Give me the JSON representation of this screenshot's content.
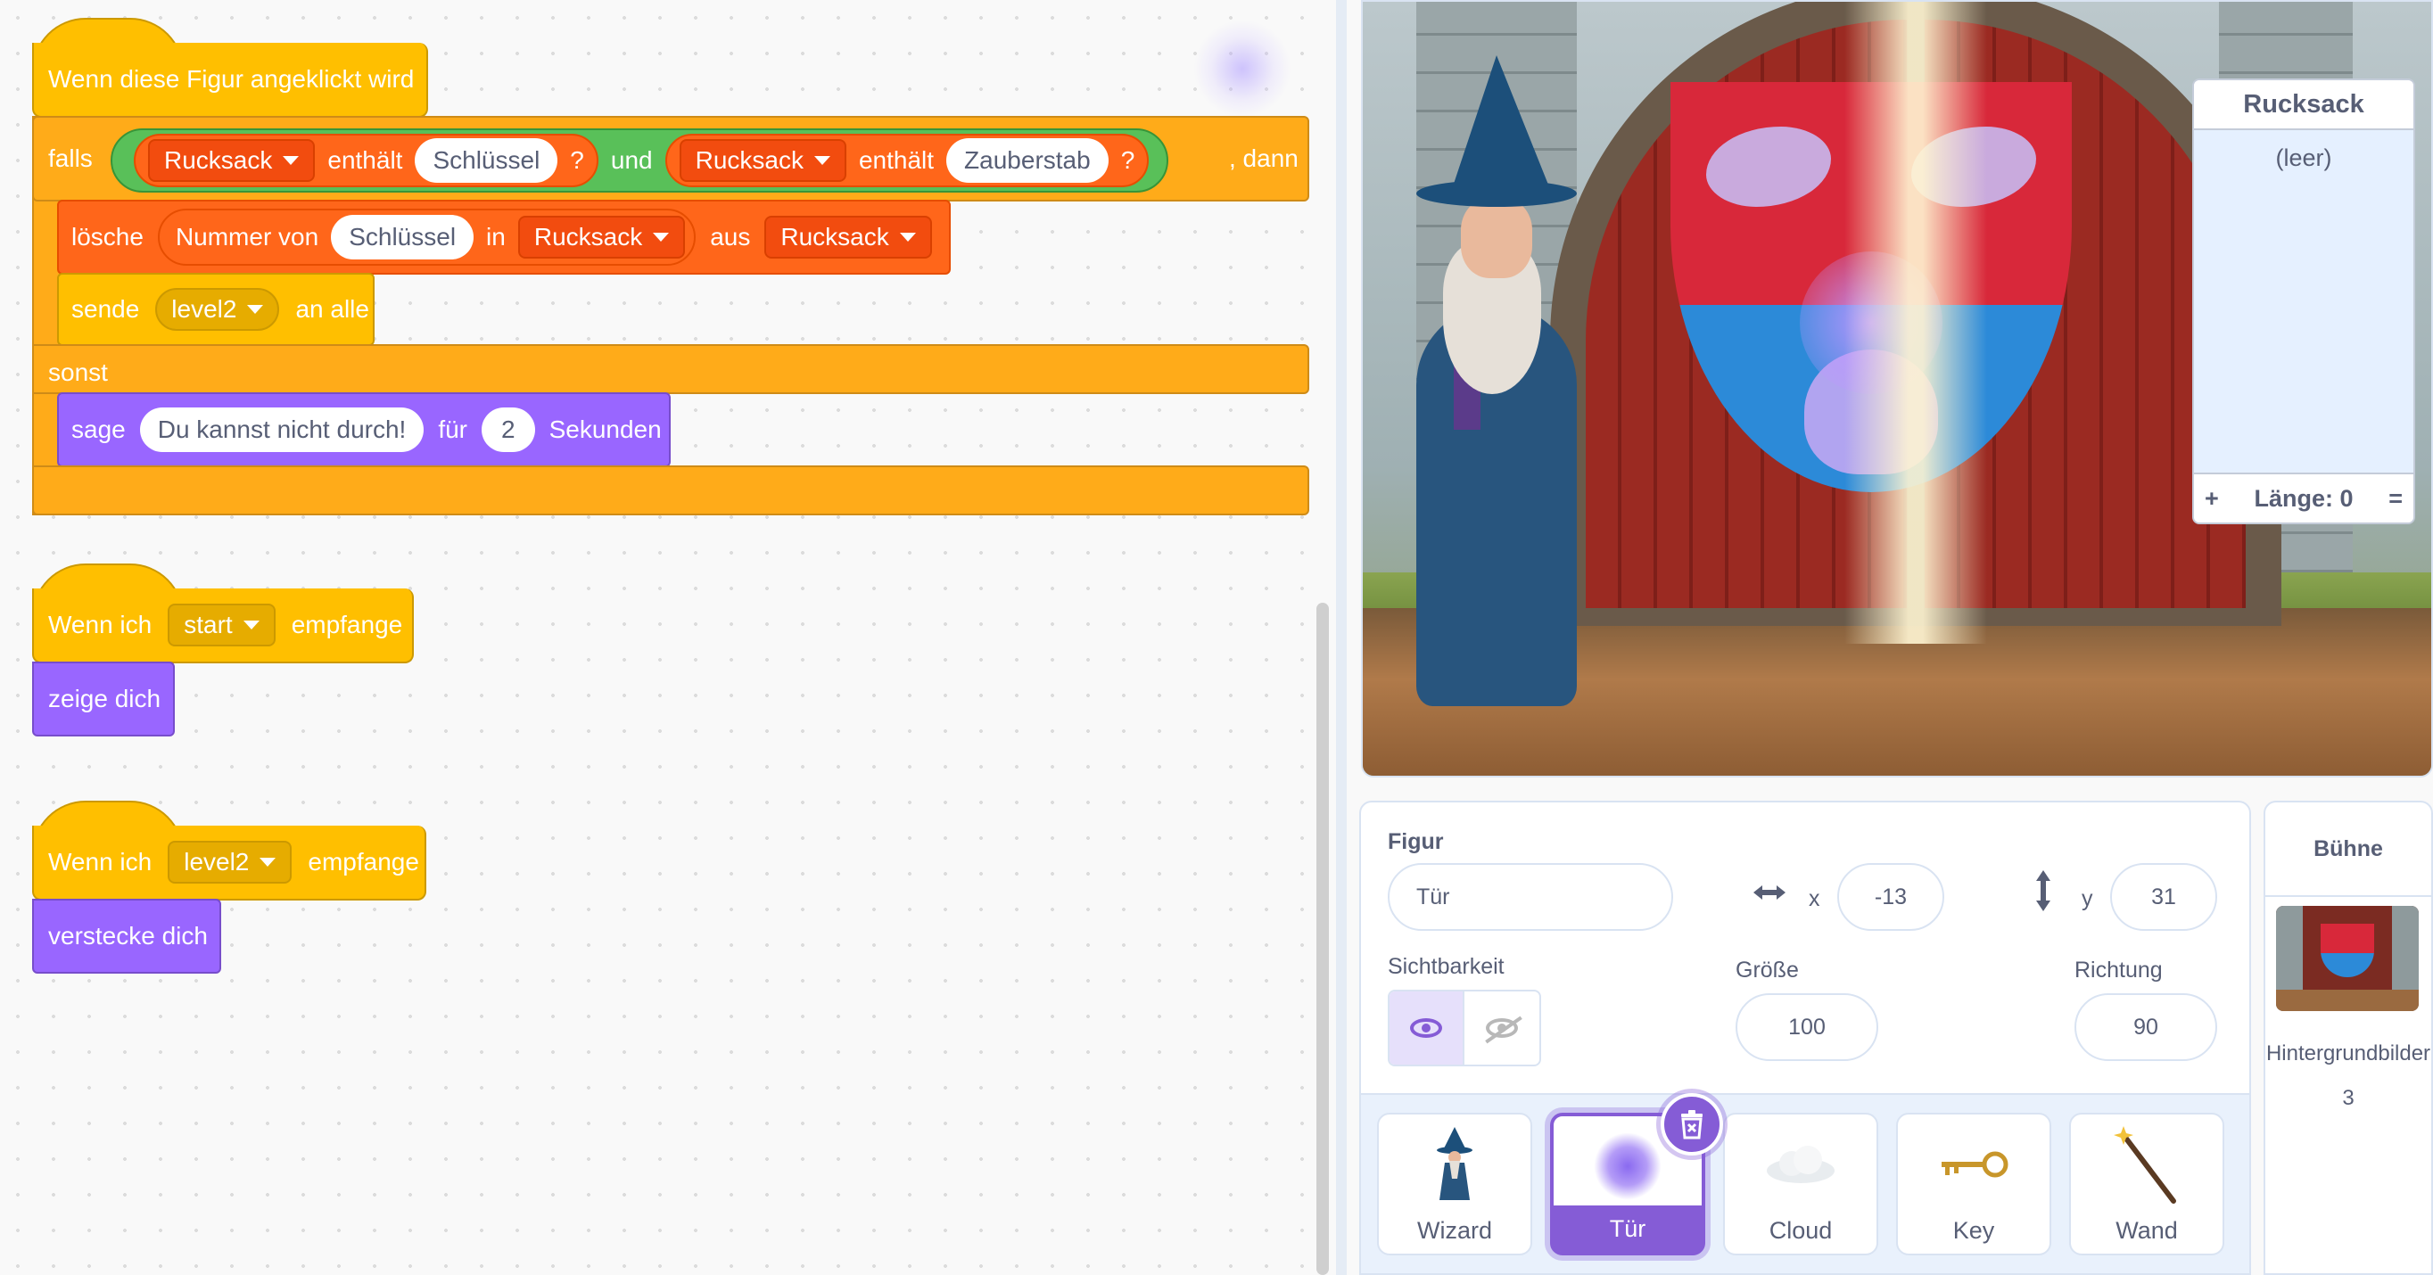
{
  "scripts": {
    "s1": {
      "hat": "Wenn diese Figur angeklickt wird",
      "if_label": "falls",
      "list1": "Rucksack",
      "contains1": "enthält",
      "item1": "Schlüssel",
      "q1": "?",
      "and_label": "und",
      "list2": "Rucksack",
      "contains2": "enthält",
      "item2": "Zauberstab",
      "q2": "?",
      "then_label": ", dann",
      "delete_label": "lösche",
      "number_of": "Nummer von",
      "item3": "Schlüssel",
      "in_label": "in",
      "list3": "Rucksack",
      "from_label": "aus",
      "list4": "Rucksack",
      "send_label": "sende",
      "message": "level2",
      "to_all": "an alle",
      "else_label": "sonst",
      "say_label": "sage",
      "say_text": "Du kannst nicht durch!",
      "for_label": "für",
      "secs": "2",
      "seconds_label": "Sekunden"
    },
    "s2": {
      "when": "Wenn ich",
      "message": "start",
      "receive": "empfange",
      "action": "zeige dich"
    },
    "s3": {
      "when": "Wenn ich",
      "message": "level2",
      "receive": "empfange",
      "action": "verstecke dich"
    }
  },
  "list_monitor": {
    "title": "Rucksack",
    "empty": "(leer)",
    "plus": "+",
    "length": "Länge: 0",
    "equals": "="
  },
  "sprite_info": {
    "sprite_label": "Figur",
    "sprite_name": "Tür",
    "x_label": "x",
    "x": "-13",
    "y_label": "y",
    "y": "31",
    "visibility_label": "Sichtbarkeit",
    "size_label": "Größe",
    "size": "100",
    "direction_label": "Richtung",
    "direction": "90"
  },
  "sprites": [
    {
      "name": "Wizard",
      "icon": "wizard-icon",
      "selected": false
    },
    {
      "name": "Tür",
      "icon": "door-glow-icon",
      "selected": true
    },
    {
      "name": "Cloud",
      "icon": "cloud-icon",
      "selected": false
    },
    {
      "name": "Key",
      "icon": "key-icon",
      "selected": false
    },
    {
      "name": "Wand",
      "icon": "wand-icon",
      "selected": false
    }
  ],
  "stage_panel": {
    "title": "Bühne",
    "backdrops_label": "Hintergrundbilder",
    "backdrops_count": "3"
  },
  "colors": {
    "events": "#ffbf00",
    "control": "#ffab19",
    "lists": "#ff661a",
    "looks": "#9966ff",
    "operators": "#59c059",
    "accent": "#855cd6"
  }
}
